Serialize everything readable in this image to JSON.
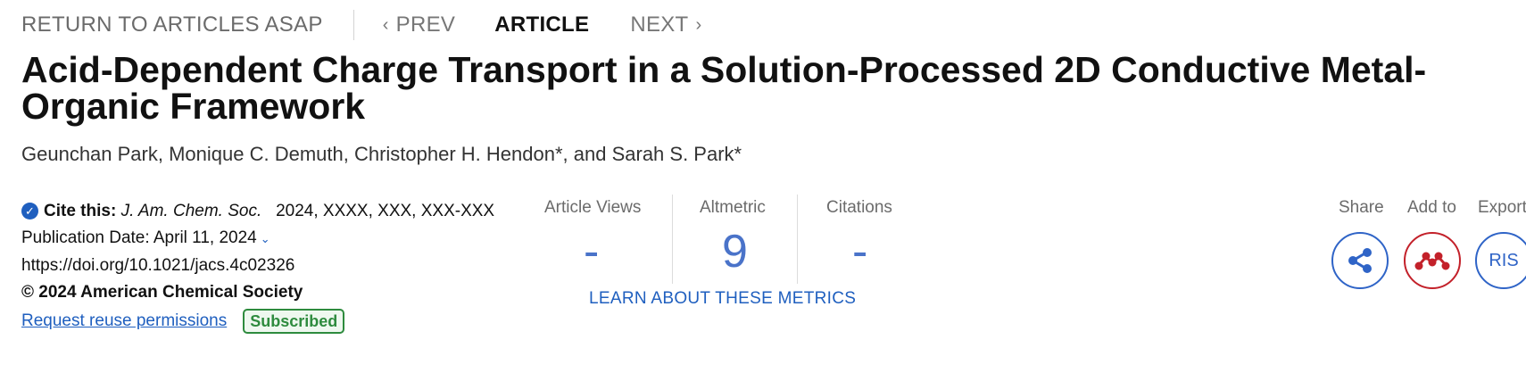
{
  "nav": {
    "return_label": "RETURN TO ARTICLES ASAP",
    "prev_label": "PREV",
    "article_label": "ARTICLE",
    "next_label": "NEXT"
  },
  "article": {
    "title": "Acid-Dependent Charge Transport in a Solution-Processed 2D Conductive Metal-Organic Framework",
    "authors": "Geunchan Park, Monique C. Demuth, Christopher H. Hendon*, and Sarah S. Park*"
  },
  "citation": {
    "label": "Cite this:",
    "journal": "J. Am. Chem. Soc.",
    "details": "2024, XXXX, XXX, XXX-XXX",
    "publication_date": "Publication Date: April 11, 2024",
    "doi": "https://doi.org/10.1021/jacs.4c02326",
    "copyright": "© 2024 American Chemical Society",
    "reuse_link": "Request reuse permissions",
    "access_badge": "Subscribed"
  },
  "metrics": {
    "views_label": "Article Views",
    "views_value": "-",
    "altmetric_label": "Altmetric",
    "altmetric_value": "9",
    "citations_label": "Citations",
    "citations_value": "-",
    "learn_link": "LEARN ABOUT THESE METRICS"
  },
  "actions": {
    "share_label": "Share",
    "share_icon": "share-icon",
    "add_to_label": "Add to",
    "add_to_icon": "mendeley-icon",
    "export_label": "Export",
    "export_button": "RIS"
  },
  "colors": {
    "accent_blue": "#1f5fbf",
    "metric_blue": "#4a73c9",
    "mendeley_red": "#c3212a",
    "subscribed_green": "#2e8b3e"
  }
}
